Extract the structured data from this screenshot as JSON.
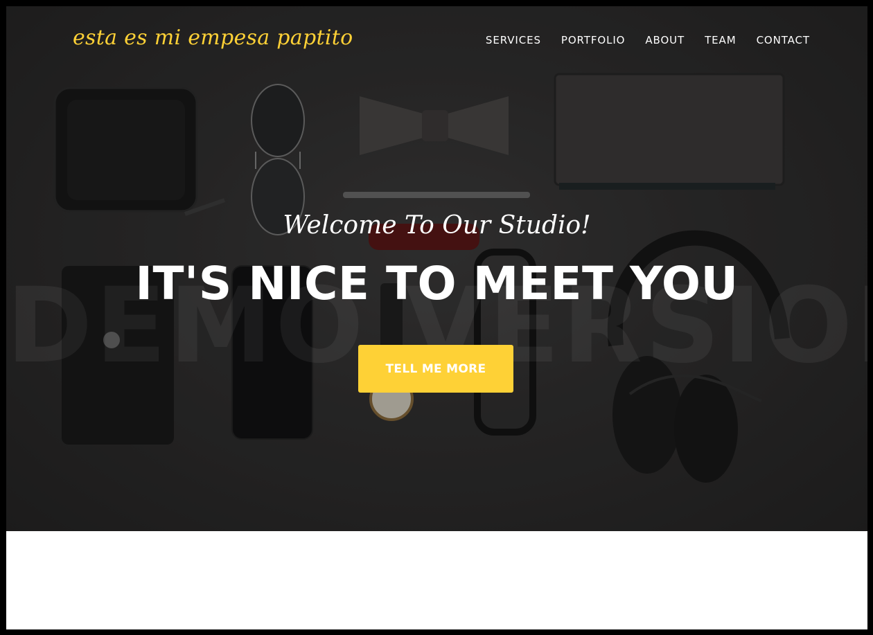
{
  "navbar": {
    "brand": "esta es mi empesa paptito",
    "links": [
      {
        "label": "SERVICES"
      },
      {
        "label": "PORTFOLIO"
      },
      {
        "label": "ABOUT"
      },
      {
        "label": "TEAM"
      },
      {
        "label": "CONTACT"
      }
    ]
  },
  "hero": {
    "lead": "Welcome To Our Studio!",
    "heading": "IT'S NICE TO MEET YOU",
    "button_label": "TELL ME MORE",
    "watermark": "DEMO VERSION"
  },
  "colors": {
    "accent": "#fed136",
    "hero_background": "#2f2e2e",
    "nav_text": "#ffffff",
    "page_background": "#ffffff"
  }
}
